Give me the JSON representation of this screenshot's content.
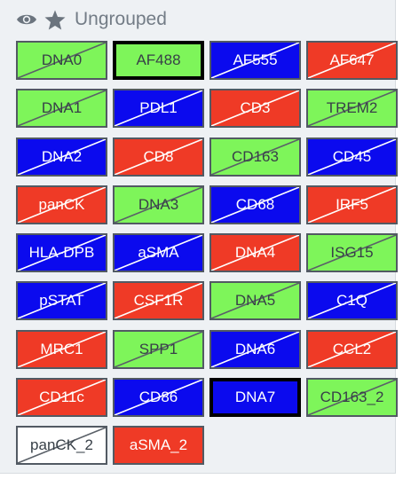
{
  "group": {
    "title": "Ungrouped",
    "icons": [
      "eye-icon",
      "star-icon"
    ]
  },
  "colors": {
    "green": "#7ef55a",
    "blue": "#0b0aee",
    "red": "#ef3a26",
    "white": "#ffffff",
    "border": "#525a63",
    "selected_border": "#000000"
  },
  "channels": [
    {
      "label": "DNA0",
      "color": "green",
      "crossed": true,
      "selected": false
    },
    {
      "label": "AF488",
      "color": "green",
      "crossed": false,
      "selected": true
    },
    {
      "label": "AF555",
      "color": "blue",
      "crossed": true,
      "selected": false
    },
    {
      "label": "AF647",
      "color": "red",
      "crossed": true,
      "selected": false
    },
    {
      "label": "DNA1",
      "color": "green",
      "crossed": true,
      "selected": false
    },
    {
      "label": "PDL1",
      "color": "blue",
      "crossed": true,
      "selected": false
    },
    {
      "label": "CD3",
      "color": "red",
      "crossed": true,
      "selected": false
    },
    {
      "label": "TREM2",
      "color": "green",
      "crossed": true,
      "selected": false
    },
    {
      "label": "DNA2",
      "color": "blue",
      "crossed": true,
      "selected": false
    },
    {
      "label": "CD8",
      "color": "red",
      "crossed": true,
      "selected": false
    },
    {
      "label": "CD163",
      "color": "green",
      "crossed": true,
      "selected": false
    },
    {
      "label": "CD45",
      "color": "blue",
      "crossed": true,
      "selected": false
    },
    {
      "label": "panCK",
      "color": "red",
      "crossed": true,
      "selected": false
    },
    {
      "label": "DNA3",
      "color": "green",
      "crossed": true,
      "selected": false
    },
    {
      "label": "CD68",
      "color": "blue",
      "crossed": true,
      "selected": false
    },
    {
      "label": "IRF5",
      "color": "red",
      "crossed": true,
      "selected": false
    },
    {
      "label": "HLA-DPB",
      "color": "blue",
      "crossed": true,
      "selected": false
    },
    {
      "label": "aSMA",
      "color": "blue",
      "crossed": true,
      "selected": false
    },
    {
      "label": "DNA4",
      "color": "red",
      "crossed": true,
      "selected": false
    },
    {
      "label": "ISG15",
      "color": "green",
      "crossed": true,
      "selected": false
    },
    {
      "label": "pSTAT",
      "color": "blue",
      "crossed": true,
      "selected": false
    },
    {
      "label": "CSF1R",
      "color": "red",
      "crossed": true,
      "selected": false
    },
    {
      "label": "DNA5",
      "color": "green",
      "crossed": true,
      "selected": false
    },
    {
      "label": "C1Q",
      "color": "blue",
      "crossed": true,
      "selected": false
    },
    {
      "label": "MRC1",
      "color": "red",
      "crossed": true,
      "selected": false
    },
    {
      "label": "SPP1",
      "color": "green",
      "crossed": true,
      "selected": false
    },
    {
      "label": "DNA6",
      "color": "blue",
      "crossed": true,
      "selected": false
    },
    {
      "label": "CCL2",
      "color": "red",
      "crossed": true,
      "selected": false
    },
    {
      "label": "CD11c",
      "color": "red",
      "crossed": true,
      "selected": false
    },
    {
      "label": "CD86",
      "color": "blue",
      "crossed": true,
      "selected": false
    },
    {
      "label": "DNA7",
      "color": "blue",
      "crossed": false,
      "selected": true
    },
    {
      "label": "CD163_2",
      "color": "green",
      "crossed": true,
      "selected": false
    },
    {
      "label": "panCK_2",
      "color": "white",
      "crossed": true,
      "selected": false
    },
    {
      "label": "aSMA_2",
      "color": "red",
      "crossed": false,
      "selected": false
    }
  ]
}
